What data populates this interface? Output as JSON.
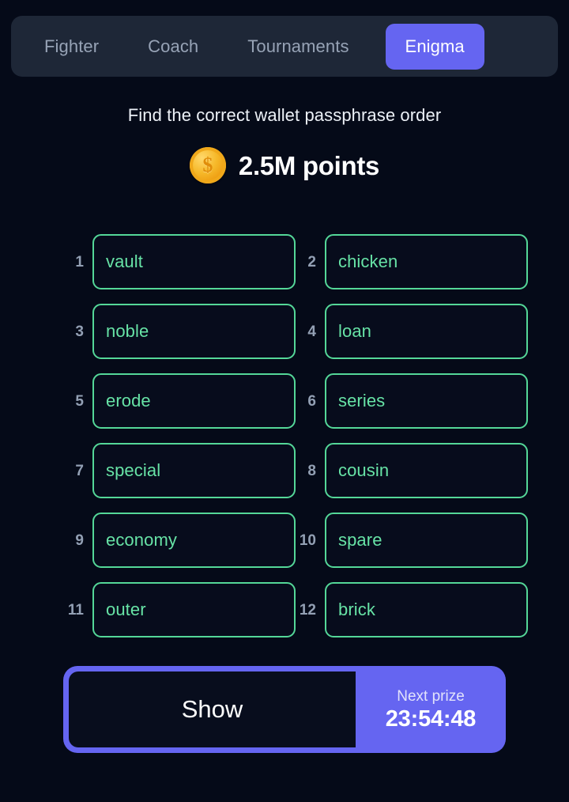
{
  "theme": {
    "background": "#050a18",
    "accent": "#6565f1",
    "word_border": "#54d798",
    "word_text": "#67e3a6",
    "navbar_bg": "#1e2737",
    "muted_text": "#97a3b6",
    "coin_color": "#f6b92a"
  },
  "navbar": {
    "tabs": [
      {
        "label": "Fighter",
        "active": false
      },
      {
        "label": "Coach",
        "active": false
      },
      {
        "label": "Tournaments",
        "active": false
      },
      {
        "label": "Enigma",
        "active": true
      }
    ]
  },
  "header": {
    "title": "Find the correct wallet passphrase order",
    "reward": {
      "icon": "coin-icon",
      "amount": "2.5M points"
    }
  },
  "passphrase": {
    "words": [
      {
        "index": "1",
        "word": "vault"
      },
      {
        "index": "2",
        "word": "chicken"
      },
      {
        "index": "3",
        "word": "noble"
      },
      {
        "index": "4",
        "word": "loan"
      },
      {
        "index": "5",
        "word": "erode"
      },
      {
        "index": "6",
        "word": "series"
      },
      {
        "index": "7",
        "word": "special"
      },
      {
        "index": "8",
        "word": "cousin"
      },
      {
        "index": "9",
        "word": "economy"
      },
      {
        "index": "10",
        "word": "spare"
      },
      {
        "index": "11",
        "word": "outer"
      },
      {
        "index": "12",
        "word": "brick"
      }
    ]
  },
  "footer": {
    "show_label": "Show",
    "prize_label": "Next prize",
    "prize_timer": "23:54:48"
  }
}
